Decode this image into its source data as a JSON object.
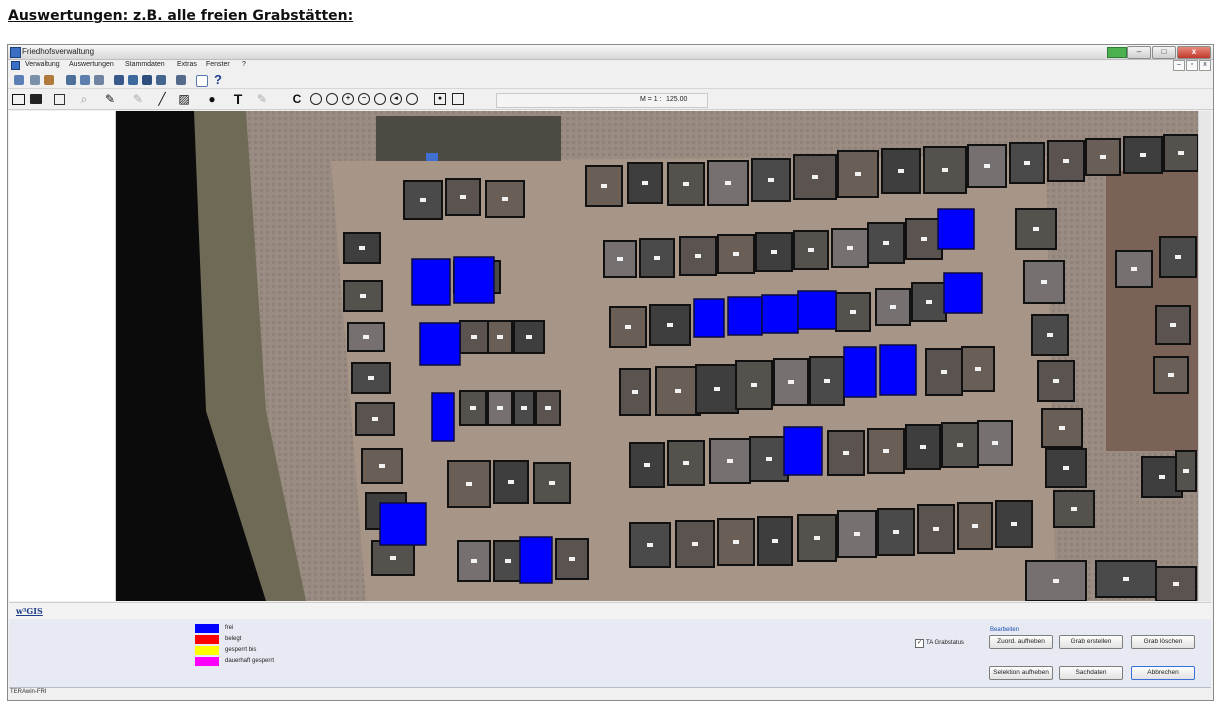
{
  "heading": "Auswertungen: z.B. alle freien Grabstätten:",
  "window": {
    "title": "Friedhofsverwaltung",
    "controls": {
      "minimize": "–",
      "maximize": "□",
      "close": "x"
    }
  },
  "menu": [
    "Verwaltung",
    "Auswertungen",
    "Stammdaten",
    "Extras",
    "Fenster",
    "?"
  ],
  "mdi_controls": [
    "–",
    "▫",
    "x"
  ],
  "toolbar2": {
    "scale_label": "M = 1 :",
    "scale_value": "125.00",
    "text_tool": "T",
    "refresh_tool": "C"
  },
  "statusbar": {
    "logo": "w³GIS"
  },
  "legend": [
    {
      "label": "frei",
      "color": "#0000ff"
    },
    {
      "label": "belegt",
      "color": "#ff0000"
    },
    {
      "label": "gesperrt bis",
      "color": "#ffff00"
    },
    {
      "label": "dauerhaft gesperrt",
      "color": "#ff00ff"
    }
  ],
  "checkbox": {
    "label": "TA Grabstatus",
    "checked_mark": "✓"
  },
  "edit_group": {
    "title": "Bearbeiten",
    "buttons": {
      "zuord_aufheben": "Zuord. aufheben",
      "grab_erstellen": "Grab erstellen",
      "grab_loeschen": "Grab löschen",
      "selektion_aufheben": "Selektion aufheben",
      "sachdaten": "Sachdaten",
      "abbrechen": "Abbrechen"
    }
  },
  "footer": "TERAwin-FRI",
  "map": {
    "free_color": "#0000ff",
    "free_graves": 15
  }
}
